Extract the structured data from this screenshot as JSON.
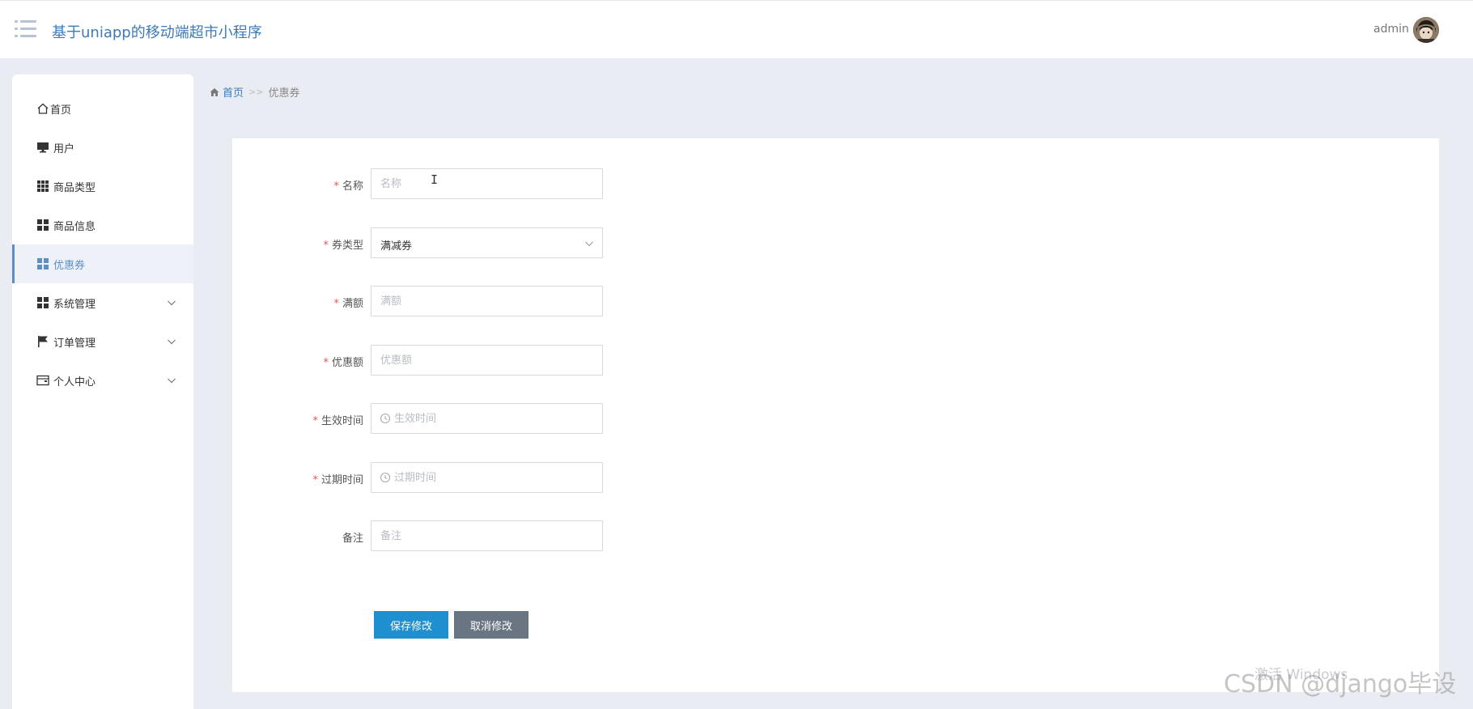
{
  "header": {
    "app_title": "基于uniapp的移动端超市小程序",
    "user_name": "admin"
  },
  "sidebar": {
    "items": [
      {
        "label": "首页",
        "icon": "home-icon"
      },
      {
        "label": "用户",
        "icon": "monitor-icon"
      },
      {
        "label": "商品类型",
        "icon": "grid-icon"
      },
      {
        "label": "商品信息",
        "icon": "tiles-icon"
      },
      {
        "label": "优惠券",
        "icon": "tiles-icon",
        "active": true
      },
      {
        "label": "系统管理",
        "icon": "tiles-icon",
        "expandable": true
      },
      {
        "label": "订单管理",
        "icon": "flag-icon",
        "expandable": true
      },
      {
        "label": "个人中心",
        "icon": "wallet-icon",
        "expandable": true
      }
    ]
  },
  "breadcrumb": {
    "home": "首页",
    "separator": ">>",
    "current": "优惠券"
  },
  "form": {
    "name": {
      "label": "名称",
      "placeholder": "名称",
      "value": ""
    },
    "coupon_type": {
      "label": "券类型",
      "value": "满减券"
    },
    "full_amount": {
      "label": "满额",
      "placeholder": "满额",
      "value": ""
    },
    "discount": {
      "label": "优惠额",
      "placeholder": "优惠额",
      "value": ""
    },
    "start_time": {
      "label": "生效时间",
      "placeholder": "生效时间",
      "value": ""
    },
    "expire_time": {
      "label": "过期时间",
      "placeholder": "过期时间",
      "value": ""
    },
    "remark": {
      "label": "备注",
      "placeholder": "备注",
      "value": ""
    },
    "required_mark": "*"
  },
  "buttons": {
    "save": "保存修改",
    "cancel": "取消修改"
  },
  "watermarks": {
    "windows": "激活 Windows",
    "csdn": "CSDN @django毕设"
  },
  "colors": {
    "accent": "#3d7ab6",
    "save_button": "#1e90d0",
    "cancel_button": "#6a7583",
    "required": "#e85656",
    "background": "#e9ecf3"
  }
}
